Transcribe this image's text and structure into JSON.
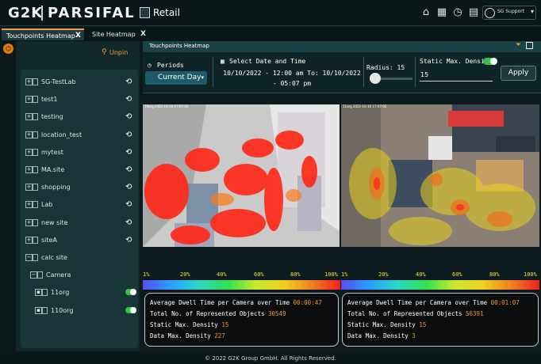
{
  "app": {
    "brand_left": "G2K",
    "brand_right": "PARSIFAL",
    "module": "Retail",
    "user": "SG Support"
  },
  "header_icons": [
    "home-icon",
    "grid-icon",
    "settings-clock-icon",
    "document-icon",
    "help-icon",
    "user-icon"
  ],
  "tabs": [
    {
      "label": "Touchpoints Heatmap",
      "close": "X",
      "active": true
    },
    {
      "label": "Site Heatmap",
      "close": "X",
      "active": false
    }
  ],
  "sidebar": {
    "unpin_label": "Unpin",
    "tree": [
      {
        "label": "SG-TestLab",
        "kind": "site"
      },
      {
        "label": "test1",
        "kind": "site"
      },
      {
        "label": "testing",
        "kind": "site"
      },
      {
        "label": "location_test",
        "kind": "site"
      },
      {
        "label": "mytest",
        "kind": "site"
      },
      {
        "label": "MA.site",
        "kind": "site"
      },
      {
        "label": "shopping",
        "kind": "site"
      },
      {
        "label": "Lab",
        "kind": "site"
      },
      {
        "label": "new site",
        "kind": "site"
      },
      {
        "label": "siteA",
        "kind": "site"
      },
      {
        "label": "calc site",
        "kind": "site-expanded"
      },
      {
        "label": "Camera",
        "kind": "folder"
      },
      {
        "label": "11org",
        "kind": "camera"
      },
      {
        "label": "110org",
        "kind": "camera"
      }
    ]
  },
  "panel": {
    "title": "Touchpoints Heatmap",
    "periods_label": "Periods",
    "period_value": "Current Day",
    "date_label": "Select Date and Time",
    "date_range": "10/10/2022 - 12:00 am To: 10/10/2022 - 05:07 pm",
    "radius_label": "Radius: 15",
    "radius_value": 0.05,
    "density_label": "Static Max. Density",
    "density_value": "15",
    "density_enabled": true,
    "apply_label": "Apply"
  },
  "cameras": [
    {
      "stamp": "19org 2022-10-10 17:07:03",
      "scale": [
        "1%",
        "20%",
        "40%",
        "60%",
        "80%",
        "100%"
      ],
      "stats": [
        {
          "label": "Average Dwell Time per Camera over Time",
          "value": "00:00:47"
        },
        {
          "label": "Total No. of Represented Objects",
          "value": "30549"
        },
        {
          "label": "Static Max. Density",
          "value": "15"
        },
        {
          "label": "Data Max. Density",
          "value": "227"
        }
      ]
    },
    {
      "stamp": "11org 2022-10-10 17:07:02",
      "scale": [
        "1%",
        "20%",
        "40%",
        "60%",
        "80%",
        "100%"
      ],
      "stats": [
        {
          "label": "Average Dwell Time per Camera over Time",
          "value": "00:01:07"
        },
        {
          "label": "Total No. of Represented Objects",
          "value": "56391"
        },
        {
          "label": "Static Max. Density",
          "value": "15"
        },
        {
          "label": "Data Max. Density",
          "value": "3"
        }
      ]
    }
  ],
  "colors": {
    "accent": "#e8a13a",
    "toggle_on": "#35c04a",
    "value_text": "#f29b2b",
    "scale_text": "#f2e043"
  },
  "footer": "© 2022 G2K Group GmbH. All Rights Reserved."
}
